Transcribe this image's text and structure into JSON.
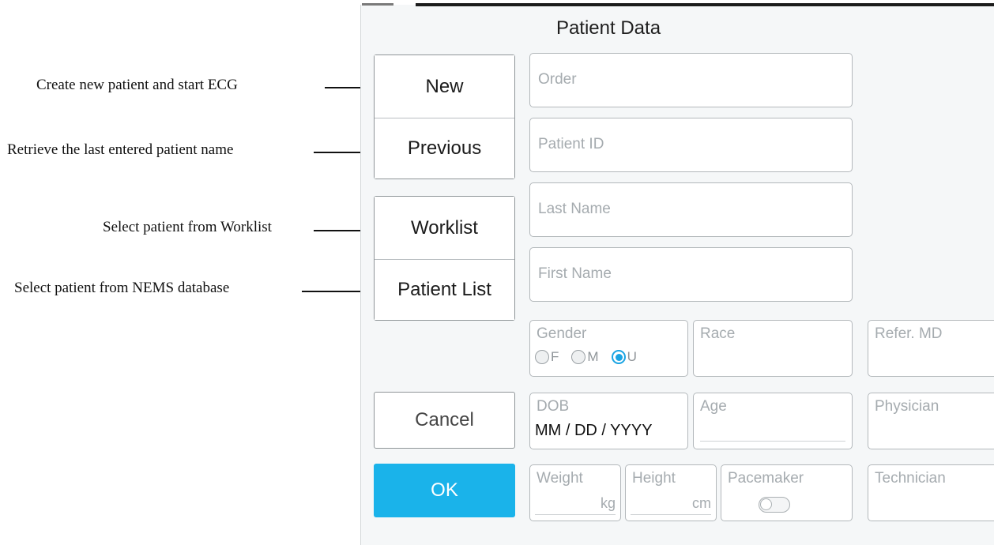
{
  "annotations": [
    {
      "text": "Create new patient and start ECG"
    },
    {
      "text": "Retrieve the last entered patient name"
    },
    {
      "text": "Select patient from Worklist"
    },
    {
      "text": "Select patient from NEMS database"
    }
  ],
  "dialog": {
    "title": "Patient Data",
    "buttons": {
      "new": "New",
      "previous": "Previous",
      "worklist": "Worklist",
      "patient_list": "Patient List",
      "cancel": "Cancel",
      "ok": "OK"
    },
    "fields": {
      "order": "Order",
      "patient_id": "Patient ID",
      "last_name": "Last Name",
      "first_name": "First Name",
      "gender": {
        "label": "Gender",
        "options": [
          "F",
          "M",
          "U"
        ],
        "selected": "U"
      },
      "race": "Race",
      "refer_md": "Refer. MD",
      "dob": {
        "label": "DOB",
        "value": "MM / DD / YYYY"
      },
      "age": "Age",
      "physician": "Physician",
      "weight": {
        "label": "Weight",
        "unit": "kg"
      },
      "height": {
        "label": "Height",
        "unit": "cm"
      },
      "pacemaker": {
        "label": "Pacemaker",
        "enabled": false
      },
      "technician": "Technician"
    },
    "colors": {
      "accent": "#1ab3ea",
      "radio_selected": "#1aa4e3"
    }
  }
}
